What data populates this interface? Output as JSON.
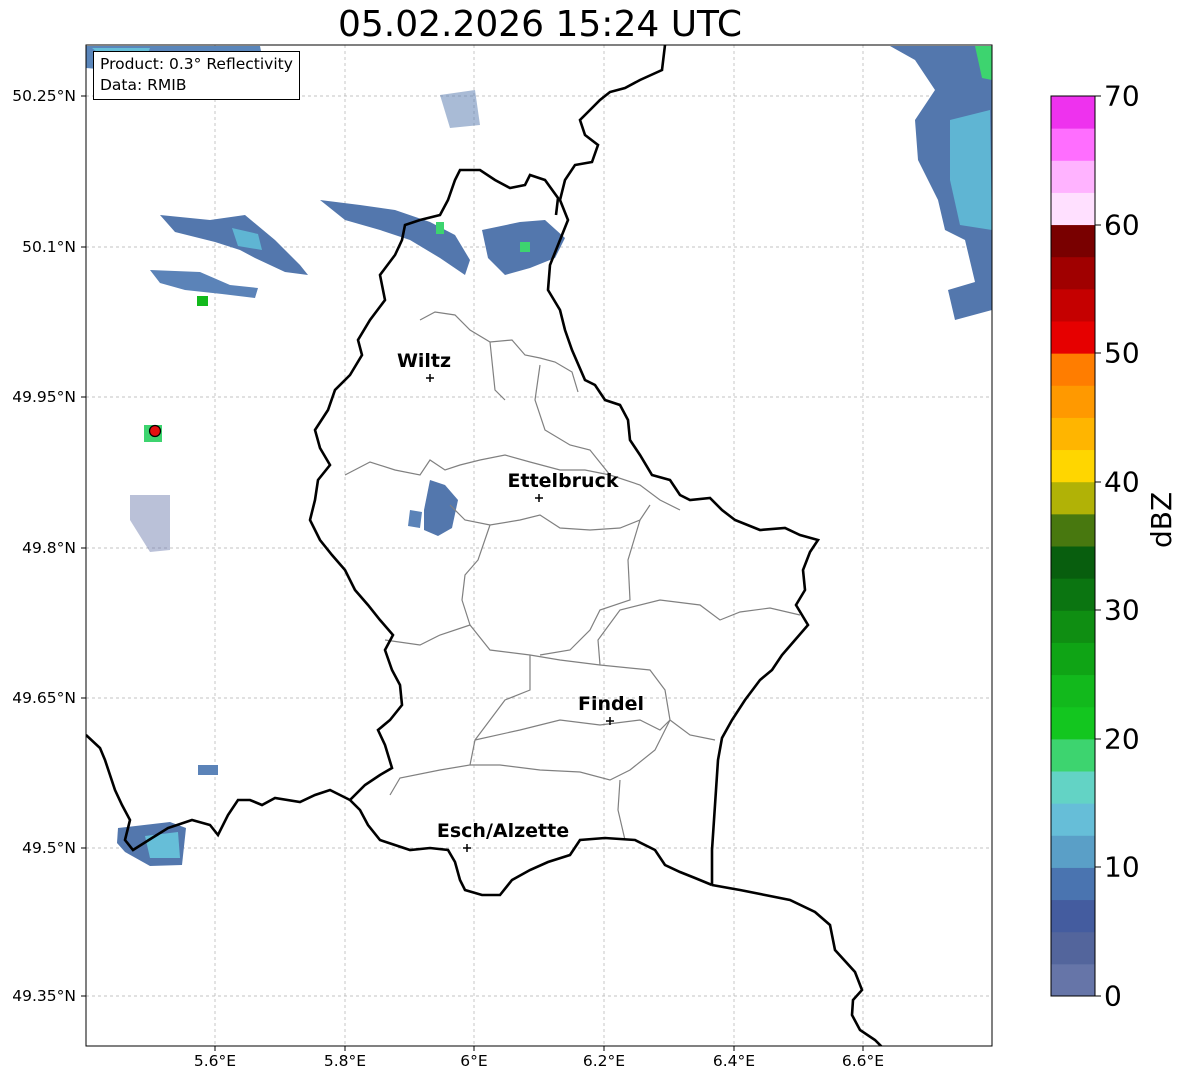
{
  "title": "05.02.2026 15:24 UTC",
  "info": {
    "product": "Product: 0.3° Reflectivity",
    "source": "Data: RMIB"
  },
  "axes": {
    "lat_ticks": [
      "50.25°N",
      "50.1°N",
      "49.95°N",
      "49.8°N",
      "49.65°N",
      "49.5°N",
      "49.35°N"
    ],
    "lon_ticks": [
      "5.6°E",
      "5.8°E",
      "6°E",
      "6.2°E",
      "6.4°E",
      "6.6°E"
    ]
  },
  "cities": [
    {
      "name": "Wiltz",
      "lon": 5.93,
      "lat": 49.967
    },
    {
      "name": "Ettelbruck",
      "lon": 6.1,
      "lat": 49.847
    },
    {
      "name": "Findel",
      "lon": 6.21,
      "lat": 49.624
    },
    {
      "name": "Esch/Alzette",
      "lon": 5.99,
      "lat": 49.498
    }
  ],
  "colorbar": {
    "label": "dBZ",
    "ticks": [
      "0",
      "10",
      "20",
      "30",
      "40",
      "50",
      "60",
      "70"
    ],
    "colors": [
      "#6675a8",
      "#53659c",
      "#445c9f",
      "#4a74b0",
      "#5a9fc7",
      "#66bed8",
      "#63d3c5",
      "#3dd46f",
      "#13c61f",
      "#12b91c",
      "#0fa415",
      "#0f8e12",
      "#0b7511",
      "#085e0e",
      "#48780f",
      "#b1b206",
      "#ffd600",
      "#ffb500",
      "#ff9900",
      "#ff7d00",
      "#e60000",
      "#c50000",
      "#a00000",
      "#790000",
      "#ffe0ff",
      "#ffb3ff",
      "#ff6eff",
      "#ee32ee"
    ]
  },
  "colors": {
    "border": "#000000",
    "canton": "#808080",
    "grid": "#b0b0b0",
    "radar_site": "#e31010"
  }
}
